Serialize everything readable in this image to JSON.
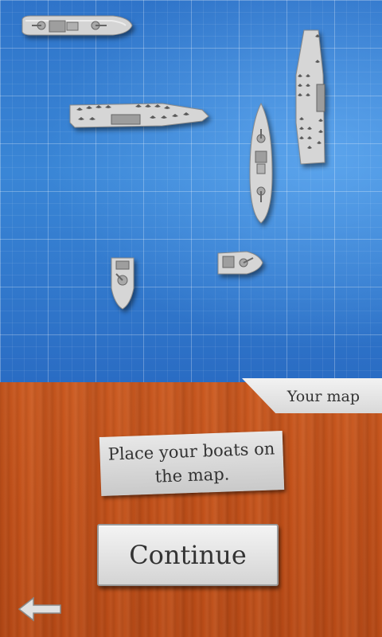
{
  "map": {
    "ships": [
      {
        "name": "battleship-horizontal",
        "icon": "battleship-icon"
      },
      {
        "name": "aircraft-carrier-horizontal",
        "icon": "aircraft-carrier-icon"
      },
      {
        "name": "aircraft-carrier-vertical",
        "icon": "aircraft-carrier-icon"
      },
      {
        "name": "cruiser-vertical",
        "icon": "cruiser-icon"
      },
      {
        "name": "patrol-boat-horizontal",
        "icon": "patrol-boat-icon"
      },
      {
        "name": "patrol-boat-vertical",
        "icon": "patrol-boat-icon"
      }
    ]
  },
  "tab": {
    "label": "Your map"
  },
  "instructions": {
    "text": "Place your boats on the map."
  },
  "continue_button": {
    "label": "Continue"
  },
  "back": {
    "icon": "back-arrow-icon"
  },
  "colors": {
    "sea": "#3a86d6",
    "wood": "#c4541c",
    "paper": "#e0e0e0",
    "ship": "#d8d8d8"
  }
}
